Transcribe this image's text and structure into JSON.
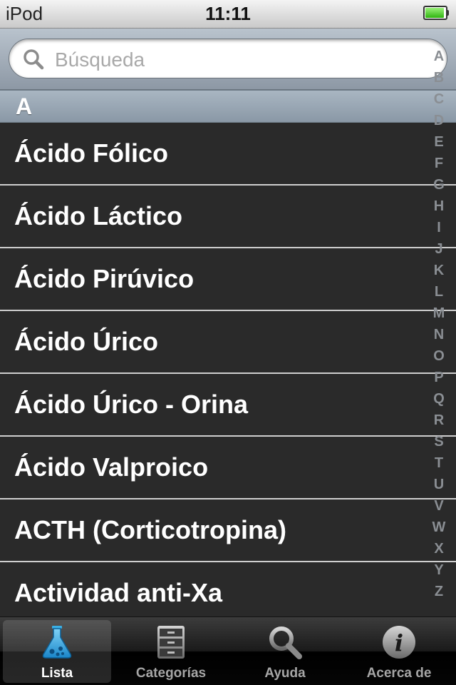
{
  "status_bar": {
    "device": "iPod",
    "time": "11:11"
  },
  "search": {
    "placeholder": "Búsqueda",
    "value": ""
  },
  "section": {
    "letter": "A"
  },
  "list": {
    "items": [
      {
        "label": "Ácido Fólico"
      },
      {
        "label": "Ácido Láctico"
      },
      {
        "label": "Ácido Pirúvico"
      },
      {
        "label": "Ácido Úrico"
      },
      {
        "label": "Ácido Úrico - Orina"
      },
      {
        "label": "Ácido Valproico"
      },
      {
        "label": "ACTH (Corticotropina)"
      },
      {
        "label": "Actividad anti-Xa"
      }
    ]
  },
  "index": {
    "letters": [
      "A",
      "B",
      "C",
      "D",
      "E",
      "F",
      "G",
      "H",
      "I",
      "J",
      "K",
      "L",
      "M",
      "N",
      "O",
      "P",
      "Q",
      "R",
      "S",
      "T",
      "U",
      "V",
      "W",
      "X",
      "Y",
      "Z"
    ]
  },
  "tab_bar": {
    "selected": "lista",
    "tabs": [
      {
        "label": "Lista",
        "icon": "flask-icon"
      },
      {
        "label": "Categorías",
        "icon": "cabinet-icon"
      },
      {
        "label": "Ayuda",
        "icon": "magnifier-icon"
      },
      {
        "label": "Acerca de",
        "icon": "info-icon"
      }
    ]
  },
  "colors": {
    "list_background": "#2a2a2a",
    "separator": "#cfcfcf",
    "battery_fill": "#2fb40f",
    "tab_selected_icon": "#3ab0e6"
  }
}
